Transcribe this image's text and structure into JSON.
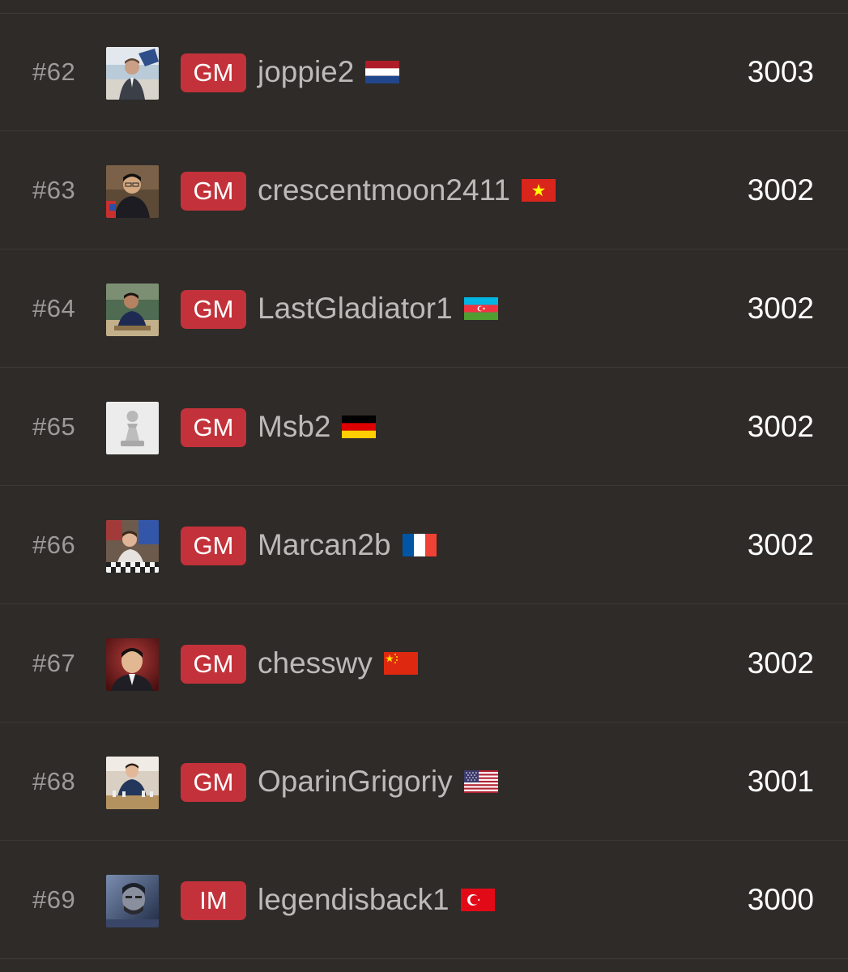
{
  "leaderboard": {
    "rows": [
      {
        "rank": "#62",
        "title": "GM",
        "username": "joppie2",
        "flag": "netherlands-flag-icon",
        "rating": "3003",
        "avatar": "player-photo-avatar"
      },
      {
        "rank": "#63",
        "title": "GM",
        "username": "crescentmoon2411",
        "flag": "vietnam-flag-icon",
        "rating": "3002",
        "avatar": "player-photo-avatar"
      },
      {
        "rank": "#64",
        "title": "GM",
        "username": "LastGladiator1",
        "flag": "azerbaijan-flag-icon",
        "rating": "3002",
        "avatar": "player-photo-avatar"
      },
      {
        "rank": "#65",
        "title": "GM",
        "username": "Msb2",
        "flag": "germany-flag-icon",
        "rating": "3002",
        "avatar": "default-pawn-avatar"
      },
      {
        "rank": "#66",
        "title": "GM",
        "username": "Marcan2b",
        "flag": "france-flag-icon",
        "rating": "3002",
        "avatar": "player-photo-avatar"
      },
      {
        "rank": "#67",
        "title": "GM",
        "username": "chesswy",
        "flag": "china-flag-icon",
        "rating": "3002",
        "avatar": "player-photo-avatar"
      },
      {
        "rank": "#68",
        "title": "GM",
        "username": "OparinGrigoriy",
        "flag": "usa-flag-icon",
        "rating": "3001",
        "avatar": "player-photo-avatar"
      },
      {
        "rank": "#69",
        "title": "IM",
        "username": "legendisback1",
        "flag": "turkey-flag-icon",
        "rating": "3000",
        "avatar": "player-photo-avatar"
      }
    ]
  },
  "colors": {
    "background": "#2e2b29",
    "divider": "#3c3936",
    "title_badge": "#c3323a",
    "rank_text": "#9c9b99",
    "username_text": "#bcbab8",
    "rating_text": "#ffffff"
  }
}
